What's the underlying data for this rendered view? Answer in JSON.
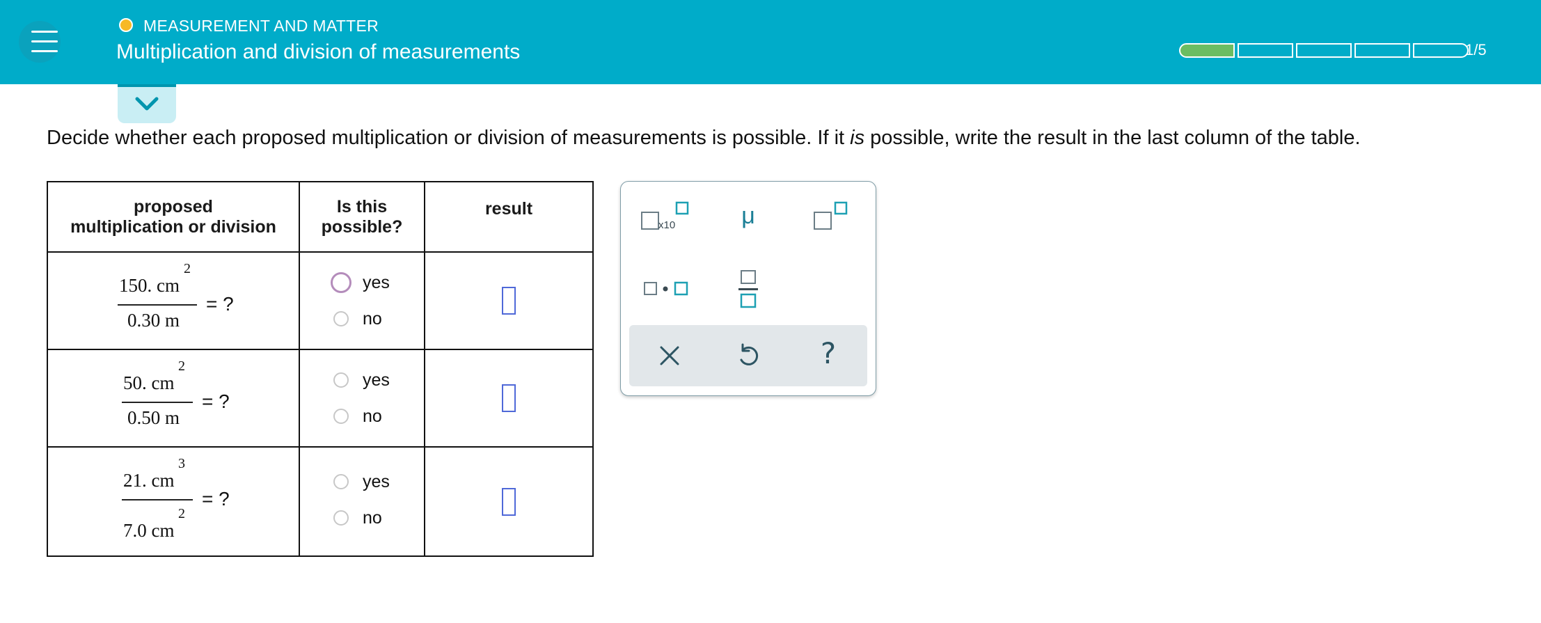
{
  "header": {
    "topic": "MEASUREMENT AND MATTER",
    "lesson_title": "Multiplication and division of measurements",
    "progress_label": "1/5",
    "progress": {
      "completed": 1,
      "total": 5
    },
    "colors": {
      "header_bg": "#00acc9",
      "topic_dot": "#f7b925",
      "progress_fill": "#6bbd62"
    }
  },
  "instructions": {
    "before": "Decide whether each proposed multiplication or division of measurements is possible. If it ",
    "emph": "is",
    "after": " possible, write the result in the last column of the table."
  },
  "table": {
    "headers": {
      "col1_line1": "proposed",
      "col1_line2": "multiplication or division",
      "col2_line1": "Is this",
      "col2_line2": "possible?",
      "col3": "result"
    },
    "rows": [
      {
        "num": "150. cm",
        "num_exp": "2",
        "den": "0.30 m",
        "den_exp": "",
        "eq": "= ?",
        "yes": "yes",
        "no": "no"
      },
      {
        "num": "50. cm",
        "num_exp": "2",
        "den": "0.50 m",
        "den_exp": "",
        "eq": "= ?",
        "yes": "yes",
        "no": "no"
      },
      {
        "num": "21. cm",
        "num_exp": "3",
        "den": "7.0 cm",
        "den_exp": "2",
        "eq": "= ?",
        "yes": "yes",
        "no": "no"
      }
    ]
  },
  "palette": {
    "x10_label": "x10",
    "mu": "μ",
    "icons": [
      "scientific-notation-icon",
      "mu-symbol-icon",
      "superscript-icon",
      "multiply-dot-icon",
      "fraction-icon",
      "clear-icon",
      "undo-icon",
      "help-icon"
    ],
    "help": "?"
  }
}
